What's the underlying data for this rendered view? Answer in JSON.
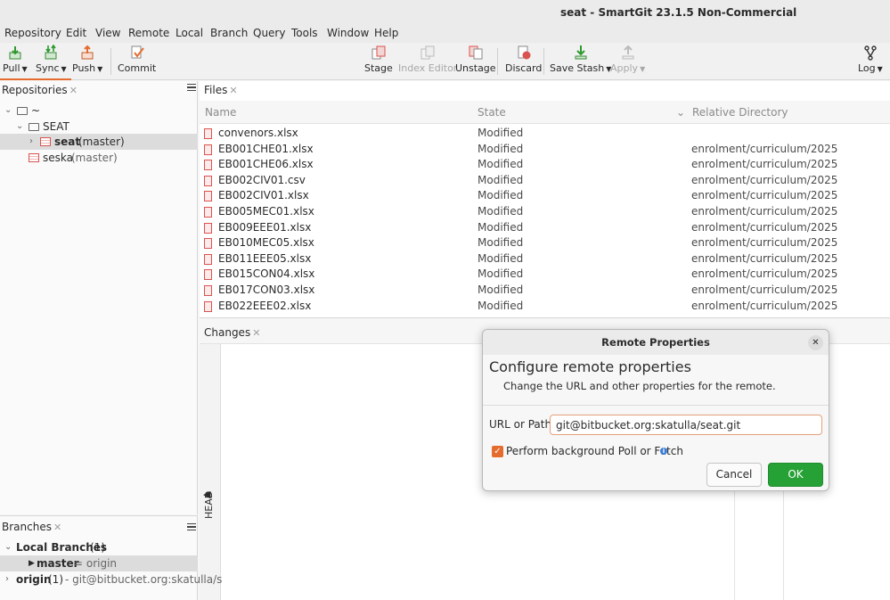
{
  "window": {
    "title": "seat - SmartGit 23.1.5 Non-Commercial"
  },
  "menu": [
    "Repository",
    "Edit",
    "View",
    "Remote",
    "Local",
    "Branch",
    "Query",
    "Tools",
    "Window",
    "Help"
  ],
  "toolbar": {
    "pull": "Pull",
    "sync": "Sync",
    "push": "Push",
    "commit": "Commit",
    "stage": "Stage",
    "index_editor": "Index Editor",
    "unstage": "Unstage",
    "discard": "Discard",
    "save_stash": "Save Stash",
    "apply": "Apply",
    "log": "Log"
  },
  "repositories": {
    "title": "Repositories",
    "root": "~",
    "group": "SEAT",
    "items": [
      {
        "name": "seat",
        "branch": "(master)"
      },
      {
        "name": "seska",
        "branch": "(master)"
      }
    ]
  },
  "files": {
    "title": "Files",
    "columns": {
      "name": "Name",
      "state": "State",
      "dir": "Relative Directory"
    },
    "rows": [
      {
        "name": "convenors.xlsx",
        "state": "Modified",
        "dir": ""
      },
      {
        "name": "EB001CHE01.xlsx",
        "state": "Modified",
        "dir": "enrolment/curriculum/2025"
      },
      {
        "name": "EB001CHE06.xlsx",
        "state": "Modified",
        "dir": "enrolment/curriculum/2025"
      },
      {
        "name": "EB002CIV01.csv",
        "state": "Modified",
        "dir": "enrolment/curriculum/2025"
      },
      {
        "name": "EB002CIV01.xlsx",
        "state": "Modified",
        "dir": "enrolment/curriculum/2025"
      },
      {
        "name": "EB005MEC01.xlsx",
        "state": "Modified",
        "dir": "enrolment/curriculum/2025"
      },
      {
        "name": "EB009EEE01.xlsx",
        "state": "Modified",
        "dir": "enrolment/curriculum/2025"
      },
      {
        "name": "EB010MEC05.xlsx",
        "state": "Modified",
        "dir": "enrolment/curriculum/2025"
      },
      {
        "name": "EB011EEE05.xlsx",
        "state": "Modified",
        "dir": "enrolment/curriculum/2025"
      },
      {
        "name": "EB015CON04.xlsx",
        "state": "Modified",
        "dir": "enrolment/curriculum/2025"
      },
      {
        "name": "EB017CON03.xlsx",
        "state": "Modified",
        "dir": "enrolment/curriculum/2025"
      },
      {
        "name": "EB022EEE02.xlsx",
        "state": "Modified",
        "dir": "enrolment/curriculum/2025"
      }
    ]
  },
  "changes": {
    "title": "Changes",
    "head_label": "HEAD"
  },
  "branches": {
    "title": "Branches",
    "local_label": "Local Branches",
    "local_count": "(1)",
    "master": "master",
    "master_tracking": "= origin",
    "origin": "origin",
    "origin_count": "(1)",
    "origin_url": "- git@bitbucket.org:skatulla/s"
  },
  "dialog": {
    "title": "Remote Properties",
    "header": "Configure remote properties",
    "subtitle": "Change the URL and other properties for the remote.",
    "url_label": "URL or Path:",
    "url_value": "git@bitbucket.org:skatulla/seat.git",
    "checkbox_label": "Perform background Poll or Fetch",
    "checkbox_checked": true,
    "cancel": "Cancel",
    "ok": "OK"
  },
  "colors": {
    "accent": "#e46c2f",
    "ok_green": "#26a136",
    "file_red": "#d9534f"
  }
}
